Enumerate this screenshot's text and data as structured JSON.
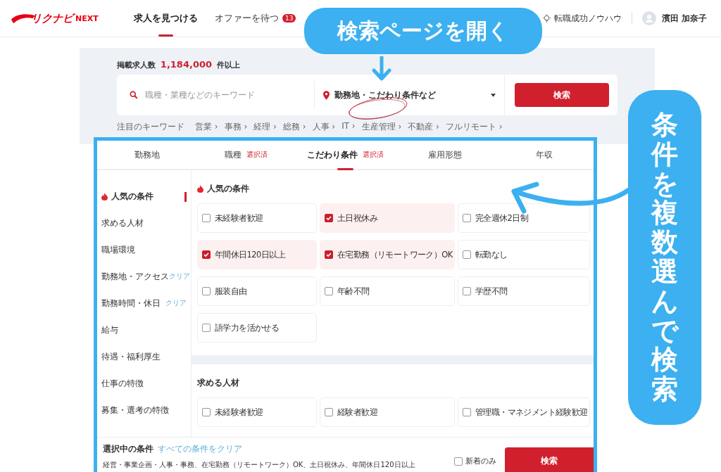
{
  "header": {
    "logo": {
      "brand": "リクナビ",
      "sub": "NEXT"
    },
    "nav": [
      {
        "label": "求人を見つける",
        "selected": true
      },
      {
        "label": "オファーを待つ",
        "selected": false,
        "badge": "13"
      }
    ],
    "tips": "転職成功ノウハウ",
    "user": "濱田 加奈子"
  },
  "search": {
    "count_label": "掲載求人数",
    "count": "1,184,000",
    "count_suffix": "件以上",
    "keyword_placeholder": "職種・業種などのキーワード",
    "location": "勤務地・こだわり条件など",
    "button": "検索",
    "keywords_label": "注目のキーワード",
    "keywords": [
      "営業 ›",
      "事務 ›",
      "経理 ›",
      "総務 ›",
      "人事 ›",
      "IT ›",
      "生産管理 ›",
      "不動産 ›",
      "フルリモート ›"
    ]
  },
  "panel": {
    "tabs": [
      {
        "label": "勤務地",
        "selected": false
      },
      {
        "label": "職種",
        "badge": "選択済",
        "selected": false
      },
      {
        "label": "こだわり条件",
        "badge": "選択済",
        "selected": true
      },
      {
        "label": "雇用形態",
        "selected": false
      },
      {
        "label": "年収",
        "selected": false
      }
    ],
    "sidebar": [
      {
        "label": "人気の条件",
        "selected": true,
        "kind": "popular"
      },
      {
        "label": "求める人材",
        "selected": false
      },
      {
        "label": "職場環境",
        "selected": false
      },
      {
        "label": "勤務地・アクセス",
        "selected": false,
        "clear": "クリア"
      },
      {
        "label": "勤務時間・休日",
        "selected": false,
        "clear": "クリア"
      },
      {
        "label": "給与",
        "selected": false
      },
      {
        "label": "待遇・福利厚生",
        "selected": false
      },
      {
        "label": "仕事の特徴",
        "selected": false
      },
      {
        "label": "募集・選考の特徴",
        "selected": false
      }
    ],
    "sections": [
      {
        "title": "人気の条件",
        "kind": "popular",
        "options": [
          {
            "label": "未経験者歓迎",
            "checked": false
          },
          {
            "label": "土日祝休み",
            "checked": true
          },
          {
            "label": "完全週休2日制",
            "checked": false
          },
          {
            "label": "年間休日120日以上",
            "checked": true
          },
          {
            "label": "在宅勤務（リモートワーク）OK",
            "checked": true
          },
          {
            "label": "転勤なし",
            "checked": false
          },
          {
            "label": "服装自由",
            "checked": false
          },
          {
            "label": "年齢不問",
            "checked": false
          },
          {
            "label": "学歴不問",
            "checked": false
          },
          {
            "label": "語学力を活かせる",
            "checked": false
          }
        ]
      },
      {
        "title": "求める人材",
        "options": [
          {
            "label": "未経験者歓迎",
            "checked": false
          },
          {
            "label": "経験者歓迎",
            "checked": false
          },
          {
            "label": "管理職・マネジメント経験歓迎",
            "checked": false
          }
        ]
      }
    ],
    "footer": {
      "title": "選択中の条件",
      "clear_link": "すべての条件をクリア",
      "summary": "経営・事業企画・人事・事務、在宅勤務（リモートワーク）OK、土日祝休み、年間休日120日以上",
      "new_only": {
        "label": "新着のみ",
        "checked": false
      },
      "button": "検索"
    }
  },
  "annotations": {
    "top_callout": "検索ページを開く",
    "side_callout": "条件を複数選んで検索"
  }
}
